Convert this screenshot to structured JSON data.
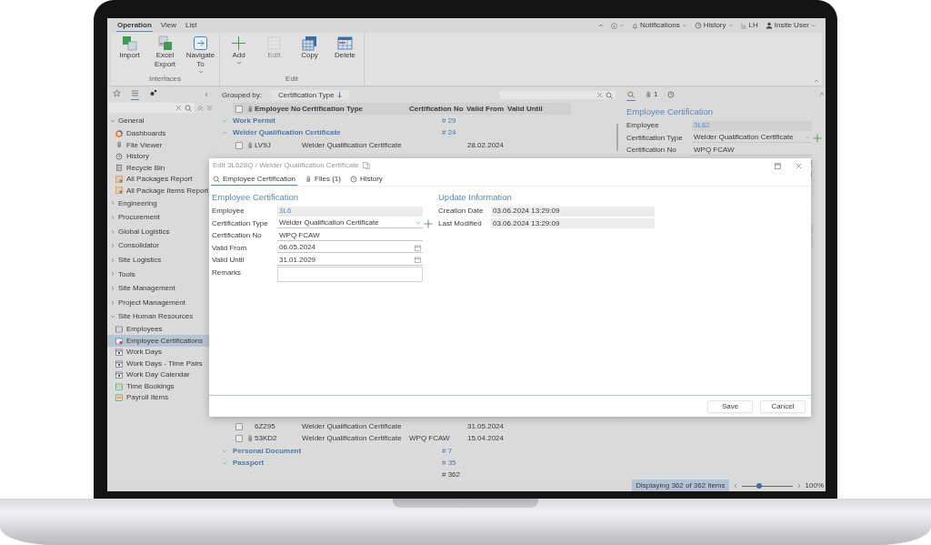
{
  "ribbon": {
    "tabs": [
      {
        "label": "Operation",
        "selected": true
      },
      {
        "label": "View",
        "selected": false
      },
      {
        "label": "List",
        "selected": false
      }
    ],
    "groups": [
      {
        "label": "Interfaces",
        "buttons": [
          {
            "kind": "import",
            "label": "Import",
            "disabled": false,
            "dropdown": false
          },
          {
            "kind": "export",
            "label": "Excel Export",
            "disabled": false,
            "dropdown": false
          },
          {
            "kind": "navigate",
            "label": "Navigate To",
            "disabled": false,
            "dropdown": true
          }
        ]
      },
      {
        "label": "Edit",
        "buttons": [
          {
            "kind": "add",
            "label": "Add",
            "disabled": false,
            "dropdown": true
          },
          {
            "kind": "edit",
            "label": "Edit",
            "disabled": true,
            "dropdown": false
          },
          {
            "kind": "copy",
            "label": "Copy",
            "disabled": false,
            "dropdown": false
          },
          {
            "kind": "delete",
            "label": "Delete",
            "disabled": false,
            "dropdown": false
          }
        ]
      }
    ]
  },
  "top_bar": {
    "notifications": "Notifications",
    "history": "History",
    "layout": "LH",
    "user": "Insite User"
  },
  "sidebar": {
    "tabs": [
      {
        "selected": false
      },
      {
        "selected": true
      },
      {
        "selected": false
      }
    ],
    "tree": [
      {
        "label": "General",
        "expanded": true,
        "children": [
          {
            "kind": "dashboard",
            "label": "Dashboards",
            "selected": false
          },
          {
            "kind": "file",
            "label": "File Viewer",
            "selected": false
          },
          {
            "kind": "history",
            "label": "History",
            "selected": false
          },
          {
            "kind": "bin",
            "label": "Recycle Bin",
            "selected": false
          },
          {
            "kind": "report",
            "label": "All Packages Report",
            "selected": false
          },
          {
            "kind": "report",
            "label": "All Package Items Report",
            "selected": false
          }
        ]
      },
      {
        "label": "Engineering",
        "expanded": false
      },
      {
        "label": "Procurement",
        "expanded": false
      },
      {
        "label": "Global Logistics",
        "expanded": false
      },
      {
        "label": "Consolidator",
        "expanded": false
      },
      {
        "label": "Site Logistics",
        "expanded": false
      },
      {
        "label": "Tools",
        "expanded": false
      },
      {
        "label": "Site Management",
        "expanded": false
      },
      {
        "label": "Project Management",
        "expanded": false
      },
      {
        "label": "Site Human Resources",
        "expanded": true,
        "children": [
          {
            "kind": "table",
            "label": "Employees",
            "selected": false
          },
          {
            "kind": "cert",
            "label": "Employee Certifications",
            "selected": true
          },
          {
            "kind": "calendar",
            "label": "Work Days",
            "selected": false
          },
          {
            "kind": "calendar",
            "label": "Work Days - Time Pairs",
            "selected": false
          },
          {
            "kind": "calendar",
            "label": "Work Day Calendar",
            "selected": false
          },
          {
            "kind": "time",
            "label": "Time Bookings",
            "selected": false
          },
          {
            "kind": "payroll",
            "label": "Payroll Items",
            "selected": false
          }
        ]
      }
    ]
  },
  "grid": {
    "all_checked": false,
    "grouped_by_label": "Grouped by:",
    "grouped_by": "Certification Type",
    "columns": [
      "Employee No",
      "Certification Type",
      "Certification No",
      "Valid From",
      "Valid Until"
    ],
    "row_blocks": [
      [
        {
          "kind": "group",
          "label": "Work Permit",
          "count": "# 29",
          "expanded": false
        },
        {
          "kind": "group",
          "label": "Welder Qualification Certificate",
          "count": "# 24",
          "expanded": true
        },
        {
          "kind": "record",
          "checked": false,
          "attachment": true,
          "employee_no": "LV9J",
          "certification_type": "Welder Qualification Certificate",
          "valid_from": "28.02.2024"
        }
      ],
      [
        {
          "kind": "record",
          "checked": false,
          "attachment": false,
          "employee_no": "6Z295",
          "certification_type": "Welder Qualification Certificate",
          "valid_from": "31.05.2024"
        },
        {
          "kind": "record",
          "checked": false,
          "attachment": true,
          "employee_no": "53KD2",
          "certification_type": "Welder Qualification Certificate",
          "certification_no": "WPQ FCAW",
          "valid_from": "15.04.2024"
        },
        {
          "kind": "group",
          "label": "Personal Document",
          "count": "# 7",
          "expanded": false
        },
        {
          "kind": "group",
          "label": "Passport",
          "count": "# 35",
          "expanded": false
        }
      ]
    ],
    "footer": "# 362"
  },
  "detail_panel": {
    "tabs": [
      {
        "selected": true
      },
      {
        "label": "1",
        "selected": false
      },
      {
        "selected": false
      }
    ],
    "title": "Employee Certification",
    "fields": [
      {
        "kind": "link",
        "label": "Employee",
        "value": "3L62"
      },
      {
        "kind": "select",
        "label": "Certification Type",
        "value": "Welder Qualification Certificate"
      },
      {
        "kind": "text",
        "label": "Certification No",
        "value": "WPQ FCAW"
      }
    ]
  },
  "dialog": {
    "title": "Edit 3L628Q / Welder Qualification Certificate",
    "tabs": [
      {
        "label": "Employee Certification",
        "selected": true
      },
      {
        "label": "Files (1)",
        "selected": false
      },
      {
        "label": "History",
        "selected": false
      }
    ],
    "sections": [
      {
        "title": "Employee Certification",
        "fields": [
          {
            "kind": "link",
            "label": "Employee",
            "value": "3L6"
          },
          {
            "kind": "select",
            "label": "Certification Type",
            "value": "Welder Qualification Certificate"
          },
          {
            "kind": "text",
            "label": "Certification No",
            "value": "WPQ FCAW"
          },
          {
            "kind": "date",
            "label": "Valid From",
            "value": "06.05.2024"
          },
          {
            "kind": "date",
            "label": "Valid Until",
            "value": "31.01.2029"
          },
          {
            "kind": "textarea",
            "label": "Remarks"
          }
        ]
      },
      {
        "title": "Update Information",
        "fields": [
          {
            "kind": "readonly",
            "label": "Creation Date",
            "value": "03.06.2024 13:29:09"
          },
          {
            "kind": "readonly",
            "label": "Last Modified",
            "value": "03.06.2024 13:29:09"
          }
        ]
      }
    ],
    "buttons": [
      "Save",
      "Cancel"
    ]
  },
  "status_bar": {
    "text": "Displaying 362 of 362 items",
    "zoom": {
      "level": 0.35
    },
    "zoom_text": "100%"
  }
}
